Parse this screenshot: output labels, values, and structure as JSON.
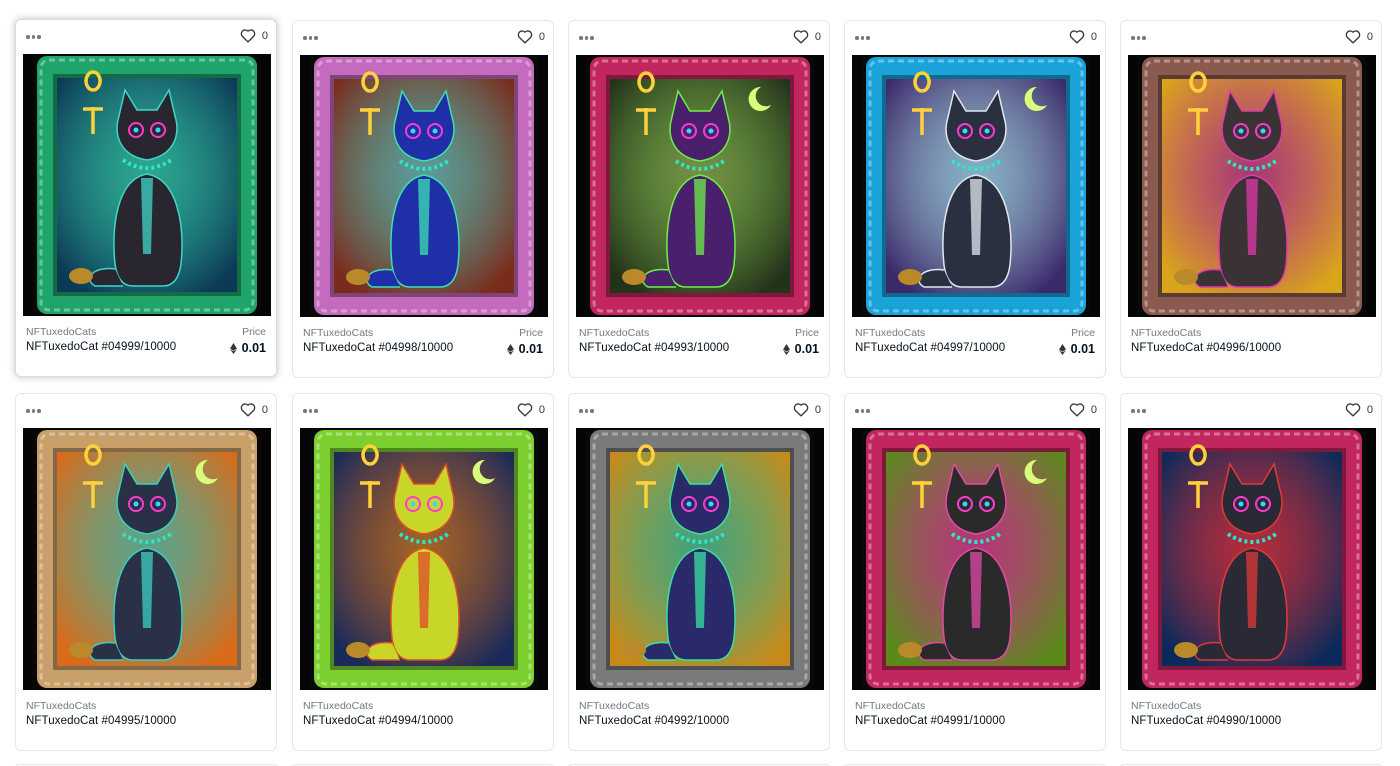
{
  "cards": [
    {
      "collection": "NFTuxedoCats",
      "name": "NFTuxedoCat #04999/10000",
      "favorites": "0",
      "price_label": "Price",
      "price": "0.01",
      "frame_color": "#1fa56b",
      "bg_color": "#0b3a55",
      "cat_color": "#2a2630",
      "accent_color": "#3fd7c7",
      "moon": false,
      "hovered": true
    },
    {
      "collection": "NFTuxedoCats",
      "name": "NFTuxedoCat #04998/10000",
      "favorites": "0",
      "price_label": "Price",
      "price": "0.01",
      "frame_color": "#c46bbd",
      "bg_color": "#7a2b1c",
      "cat_color": "#1e2fa8",
      "accent_color": "#3ee0b0",
      "moon": false
    },
    {
      "collection": "NFTuxedoCats",
      "name": "NFTuxedoCat #04993/10000",
      "favorites": "0",
      "price_label": "Price",
      "price": "0.01",
      "frame_color": "#c2265f",
      "bg_color": "#23321a",
      "cat_color": "#4a1f6b",
      "accent_color": "#6cf04a",
      "moon": true
    },
    {
      "collection": "NFTuxedoCats",
      "name": "NFTuxedoCat #04997/10000",
      "favorites": "0",
      "price_label": "Price",
      "price": "0.01",
      "frame_color": "#1aa3d9",
      "bg_color": "#3a2a6a",
      "cat_color": "#2a3040",
      "accent_color": "#e0e8f0",
      "moon": true
    },
    {
      "collection": "NFTuxedoCats",
      "name": "NFTuxedoCat #04996/10000",
      "favorites": "0",
      "price_label": "",
      "price": "",
      "frame_color": "#8a5a4e",
      "bg_color": "#d9a51a",
      "cat_color": "#3a3234",
      "accent_color": "#e03aa8",
      "moon": false
    },
    {
      "collection": "NFTuxedoCats",
      "name": "NFTuxedoCat #04995/10000",
      "favorites": "0",
      "price_label": "",
      "price": "",
      "frame_color": "#c9a06a",
      "bg_color": "#d96a1a",
      "cat_color": "#2a3046",
      "accent_color": "#3ad0c0",
      "moon": true
    },
    {
      "collection": "NFTuxedoCats",
      "name": "NFTuxedoCat #04994/10000",
      "favorites": "0",
      "price_label": "",
      "price": "",
      "frame_color": "#7ccf2e",
      "bg_color": "#1a2a5a",
      "cat_color": "#c8d62a",
      "accent_color": "#e04a2a",
      "moon": true
    },
    {
      "collection": "NFTuxedoCats",
      "name": "NFTuxedoCat #04992/10000",
      "favorites": "0",
      "price_label": "",
      "price": "",
      "frame_color": "#7a7a7a",
      "bg_color": "#c78a1a",
      "cat_color": "#2a2a6a",
      "accent_color": "#3ae0a0",
      "moon": false
    },
    {
      "collection": "NFTuxedoCats",
      "name": "NFTuxedoCat #04991/10000",
      "favorites": "0",
      "price_label": "",
      "price": "",
      "frame_color": "#c2265f",
      "bg_color": "#5a8a1a",
      "cat_color": "#2a2a2a",
      "accent_color": "#e04aa8",
      "moon": true
    },
    {
      "collection": "NFTuxedoCats",
      "name": "NFTuxedoCat #04990/10000",
      "favorites": "0",
      "price_label": "",
      "price": "",
      "frame_color": "#c2265f",
      "bg_color": "#0a2a5a",
      "cat_color": "#2a2a36",
      "accent_color": "#e03a3a",
      "moon": false
    }
  ]
}
